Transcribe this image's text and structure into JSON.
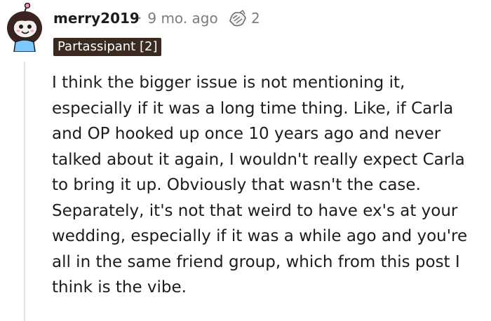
{
  "comment": {
    "author": "merry2019",
    "separator": "·",
    "time_ago": "9 mo. ago",
    "award_count": "2",
    "flair": "Partassipant [2]",
    "body": "I think the bigger issue is not mentioning it, especially if it was a long time thing. Like, if Carla and OP hooked up once 10 years ago and never talked about it again, I wouldn't really expect Carla to bring it up. Obviously that wasn't the case. Separately, it's not that weird to have ex's at your wedding, especially if it was a while ago and you're all in the same friend group, which from this post I think is the vibe."
  },
  "icons": {
    "avatar": "snoo-avatar-icon",
    "award": "hands-award-icon"
  },
  "colors": {
    "flair_background": "#3a2a22",
    "meta_text": "#7c7c7c",
    "thread_line": "#e4e4e4"
  }
}
